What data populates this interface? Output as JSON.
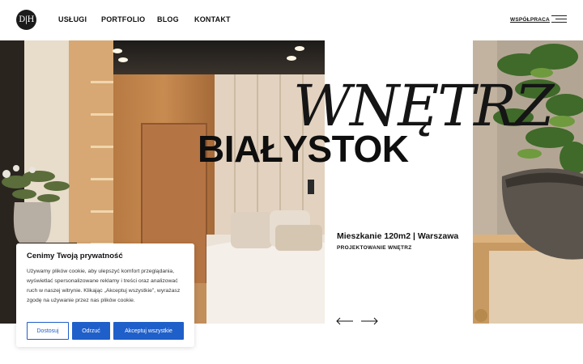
{
  "header": {
    "logo_text": "D|H",
    "nav": [
      "USŁUGI",
      "PORTFOLIO",
      "BLOG",
      "KONTAKT"
    ],
    "collab_label": "WSPÓŁPRACA"
  },
  "hero": {
    "script_title": "WNĘTRZ",
    "main_title": "BIAŁYSTOK",
    "project_name": "Mieszkanie 120m2 | Warszawa",
    "project_subtitle": "PROJEKTOWANIE WNĘTRZ"
  },
  "cookie": {
    "title": "Cenimy Twoją prywatność",
    "body": "Używamy plików cookie, aby ulepszyć komfort przeglądania, wyświetlać spersonalizowane reklamy i treści oraz analizować ruch w naszej witrynie. Klikając „Akceptuj wszystkie”, wyrażasz zgodę na używanie przez nas plików cookie.",
    "customize_label": "Dostosuj",
    "reject_label": "Odrzuć",
    "accept_label": "Akceptuj wszystkie"
  },
  "colors": {
    "accent": "#1f5fc9",
    "text": "#111111",
    "background": "#ffffff"
  }
}
